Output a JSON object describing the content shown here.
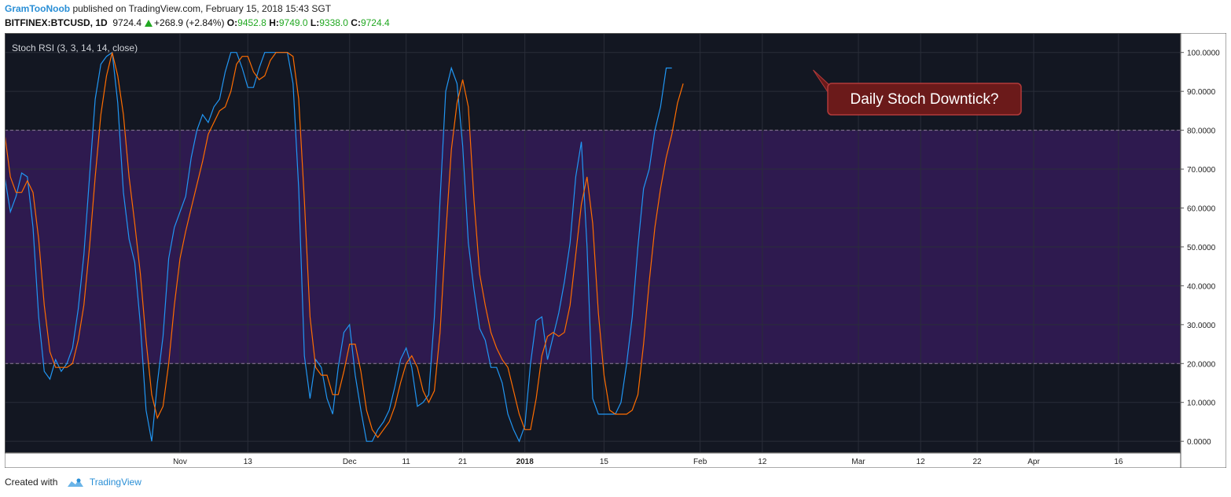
{
  "header": {
    "username": "GramTooNoob",
    "published_text": "published on TradingView.com, February 15, 2018 15:43 SGT",
    "symbol": "BITFINEX:BTCUSD, 1D",
    "last": "9724.4",
    "change": "+268.9 (+2.84%)",
    "open_label": "O:",
    "open": "9452.8",
    "high_label": "H:",
    "high": "9749.0",
    "low_label": "L:",
    "low": "9338.0",
    "close_label": "C:",
    "close": "9724.4"
  },
  "footer": {
    "created_with": "Created with",
    "brand": "TradingView"
  },
  "colors": {
    "background": "#131722",
    "band_fill": "#2e1a4f",
    "grid": "#2a2e39",
    "k_line": "#2196f3",
    "d_line": "#ff6d00",
    "band_line": "#8d7a9a",
    "callout_fill": "#6b1a1a",
    "callout_border": "#b33a3a",
    "axis_text": "#cfd2d8"
  },
  "chart_data": {
    "type": "line",
    "title": "Stoch RSI (3, 3, 14, 14, close)",
    "ylim": [
      -3,
      105
    ],
    "band": [
      20,
      80
    ],
    "y_ticks": [
      "100.0000",
      "90.0000",
      "80.0000",
      "70.0000",
      "60.0000",
      "50.0000",
      "40.0000",
      "30.0000",
      "20.0000",
      "10.0000",
      "0.0000"
    ],
    "y_tick_values": [
      100,
      90,
      80,
      70,
      60,
      50,
      40,
      30,
      20,
      10,
      0
    ],
    "x_range": [
      "2017-10-01",
      "2018-04-27"
    ],
    "x_ticks": [
      {
        "label": "Nov",
        "date": "2017-11-01",
        "bold": false
      },
      {
        "label": "13",
        "date": "2017-11-13",
        "bold": false
      },
      {
        "label": "Dec",
        "date": "2017-12-01",
        "bold": false
      },
      {
        "label": "11",
        "date": "2017-12-11",
        "bold": false
      },
      {
        "label": "21",
        "date": "2017-12-21",
        "bold": false
      },
      {
        "label": "2018",
        "date": "2018-01-01",
        "bold": true
      },
      {
        "label": "15",
        "date": "2018-01-15",
        "bold": false
      },
      {
        "label": "Feb",
        "date": "2018-02-01",
        "bold": false
      },
      {
        "label": "12",
        "date": "2018-02-12",
        "bold": false
      },
      {
        "label": "Mar",
        "date": "2018-03-01",
        "bold": false
      },
      {
        "label": "12",
        "date": "2018-03-12",
        "bold": false
      },
      {
        "label": "22",
        "date": "2018-03-22",
        "bold": false
      },
      {
        "label": "Apr",
        "date": "2018-04-01",
        "bold": false
      },
      {
        "label": "16",
        "date": "2018-04-16",
        "bold": false
      }
    ],
    "x_dates": [
      "2017-10-01",
      "2017-10-02",
      "2017-10-03",
      "2017-10-04",
      "2017-10-05",
      "2017-10-06",
      "2017-10-07",
      "2017-10-08",
      "2017-10-09",
      "2017-10-10",
      "2017-10-11",
      "2017-10-12",
      "2017-10-13",
      "2017-10-14",
      "2017-10-15",
      "2017-10-16",
      "2017-10-17",
      "2017-10-18",
      "2017-10-19",
      "2017-10-20",
      "2017-10-21",
      "2017-10-22",
      "2017-10-23",
      "2017-10-24",
      "2017-10-25",
      "2017-10-26",
      "2017-10-27",
      "2017-10-28",
      "2017-10-29",
      "2017-10-30",
      "2017-10-31",
      "2017-11-01",
      "2017-11-02",
      "2017-11-03",
      "2017-11-04",
      "2017-11-05",
      "2017-11-06",
      "2017-11-07",
      "2017-11-08",
      "2017-11-09",
      "2017-11-10",
      "2017-11-11",
      "2017-11-12",
      "2017-11-13",
      "2017-11-14",
      "2017-11-15",
      "2017-11-16",
      "2017-11-17",
      "2017-11-18",
      "2017-11-19",
      "2017-11-20",
      "2017-11-21",
      "2017-11-22",
      "2017-11-23",
      "2017-11-24",
      "2017-11-25",
      "2017-11-26",
      "2017-11-27",
      "2017-11-28",
      "2017-11-29",
      "2017-11-30",
      "2017-12-01",
      "2017-12-02",
      "2017-12-03",
      "2017-12-04",
      "2017-12-05",
      "2017-12-06",
      "2017-12-07",
      "2017-12-08",
      "2017-12-09",
      "2017-12-10",
      "2017-12-11",
      "2017-12-12",
      "2017-12-13",
      "2017-12-14",
      "2017-12-15",
      "2017-12-16",
      "2017-12-17",
      "2017-12-18",
      "2017-12-19",
      "2017-12-20",
      "2017-12-21",
      "2017-12-22",
      "2017-12-23",
      "2017-12-24",
      "2017-12-25",
      "2017-12-26",
      "2017-12-27",
      "2017-12-28",
      "2017-12-29",
      "2017-12-30",
      "2017-12-31",
      "2018-01-01",
      "2018-01-02",
      "2018-01-03",
      "2018-01-04",
      "2018-01-05",
      "2018-01-06",
      "2018-01-07",
      "2018-01-08",
      "2018-01-09",
      "2018-01-10",
      "2018-01-11",
      "2018-01-12",
      "2018-01-13",
      "2018-01-14",
      "2018-01-15",
      "2018-01-16",
      "2018-01-17",
      "2018-01-18",
      "2018-01-19",
      "2018-01-20",
      "2018-01-21",
      "2018-01-22",
      "2018-01-23",
      "2018-01-24",
      "2018-01-25",
      "2018-01-26",
      "2018-01-27",
      "2018-01-28",
      "2018-01-29",
      "2018-01-30",
      "2018-01-31",
      "2018-02-01",
      "2018-02-02",
      "2018-02-03",
      "2018-02-04",
      "2018-02-05",
      "2018-02-06",
      "2018-02-07",
      "2018-02-08",
      "2018-02-09",
      "2018-02-10",
      "2018-02-11",
      "2018-02-12",
      "2018-02-13",
      "2018-02-14",
      "2018-02-15"
    ],
    "series": [
      {
        "values": [
          68.0,
          59.0,
          63.0,
          69.0,
          68.0,
          55.0,
          32.0,
          18.0,
          16.0,
          21.0,
          18.0,
          20.0,
          24.0,
          34.0,
          48.0,
          68.0,
          88.0,
          97.0,
          99.0,
          100.0,
          87.0,
          64.0,
          52.0,
          46.0,
          30.0,
          8.0,
          0.0,
          15.0,
          27.0,
          47.0,
          55.0,
          59.0,
          63.0,
          73.0,
          80.0,
          84.0,
          82.0,
          86.0,
          88.0,
          95.0,
          100.0,
          100.0,
          96.0,
          91.0,
          91.0,
          96.0,
          100.0,
          100.0,
          100.0,
          100.0,
          100.0,
          92.0,
          65.0,
          22.0,
          11.0,
          21.0,
          19.0,
          11.0,
          7.0,
          19.0,
          28.0,
          30.0,
          17.0,
          8.0,
          0.0,
          0.0,
          3.0,
          5.0,
          8.0,
          14.0,
          21.0,
          24.0,
          19.0,
          9.0,
          10.0,
          12.0,
          32.0,
          62.0,
          90.0,
          96.0,
          92.0,
          76.0,
          51.0,
          39.0,
          29.0,
          26.0,
          19.0,
          19.0,
          15.0,
          7.0,
          3.0,
          0.0,
          4.0,
          20.0,
          31.0,
          32.0,
          21.0,
          27.0,
          33.0,
          41.0,
          51.0,
          68.0,
          77.0,
          50.0,
          11.0,
          7.0,
          7.0,
          7.0,
          7.0,
          10.0,
          20.0,
          32.0,
          50.0,
          65.0,
          70.0,
          80.0,
          86.0,
          96.0,
          96.0
        ]
      },
      {
        "values": [
          79.0,
          68.0,
          64.0,
          64.0,
          67.0,
          64.0,
          52.0,
          35.0,
          23.0,
          19.0,
          19.0,
          19.0,
          20.0,
          26.0,
          35.0,
          50.0,
          68.0,
          84.0,
          94.0,
          100.0,
          94.0,
          84.0,
          68.0,
          56.0,
          43.0,
          26.0,
          12.0,
          6.0,
          9.0,
          20.0,
          35.0,
          47.0,
          54.0,
          60.0,
          66.0,
          72.0,
          79.0,
          82.0,
          85.0,
          86.0,
          90.0,
          97.0,
          99.0,
          99.0,
          95.0,
          93.0,
          94.0,
          98.0,
          100.0,
          100.0,
          100.0,
          99.0,
          88.0,
          62.0,
          32.0,
          19.0,
          17.0,
          17.0,
          12.0,
          12.0,
          18.0,
          25.0,
          25.0,
          18.0,
          8.0,
          3.0,
          1.0,
          3.0,
          5.0,
          9.0,
          15.0,
          20.0,
          22.0,
          19.0,
          13.0,
          10.0,
          13.0,
          28.0,
          53.0,
          75.0,
          87.0,
          93.0,
          86.0,
          62.0,
          43.0,
          35.0,
          28.0,
          24.0,
          21.0,
          19.0,
          13.0,
          7.0,
          3.0,
          3.0,
          11.0,
          22.0,
          27.0,
          28.0,
          27.0,
          28.0,
          35.0,
          48.0,
          61.0,
          68.0,
          56.0,
          33.0,
          17.0,
          8.0,
          7.0,
          7.0,
          7.0,
          8.0,
          12.0,
          25.0,
          41.0,
          55.0,
          65.0,
          73.0,
          79.0,
          87.0,
          92.0
        ]
      }
    ],
    "annotation": {
      "text": "Daily Stoch Downtick?",
      "point_date": "2018-02-21",
      "point_value": 95.5
    }
  }
}
